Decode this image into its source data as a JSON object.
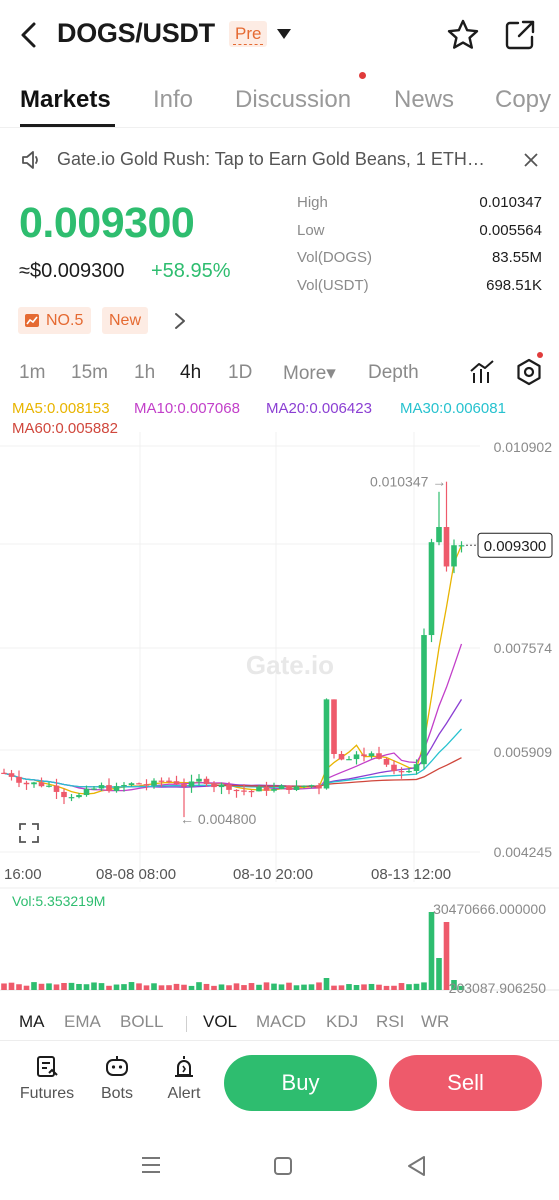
{
  "header": {
    "pair": "DOGS/USDT",
    "badge": "Pre",
    "icons": [
      "back-icon",
      "dropdown-icon",
      "star-icon",
      "share-icon"
    ]
  },
  "tabs": [
    "Markets",
    "Info",
    "Discussion",
    "News",
    "Copy"
  ],
  "active_tab": "Markets",
  "announcement": {
    "text": "Gate.io Gold Rush: Tap to Earn Gold Beans, 1 ETH…",
    "icon": "speaker-icon"
  },
  "price": {
    "last": "0.009300",
    "usd": "≈$0.009300",
    "change": "+58.95%",
    "up_color": "#2ebd6f",
    "down_color": "#ee5a6b"
  },
  "stats": [
    {
      "label": "High",
      "value": "0.010347"
    },
    {
      "label": "Low",
      "value": "0.005564"
    },
    {
      "label": "Vol(DOGS)",
      "value": "83.55M"
    },
    {
      "label": "Vol(USDT)",
      "value": "698.51K"
    }
  ],
  "badges": {
    "rank": "NO.5",
    "new": "New"
  },
  "intervals": [
    "1m",
    "15m",
    "1h",
    "4h",
    "1D",
    "More▾",
    "Depth"
  ],
  "active_interval": "4h",
  "ma_legend": [
    {
      "label": "MA5:0.008153",
      "color": "#e8b400"
    },
    {
      "label": "MA10:0.007068",
      "color": "#c23fc9"
    },
    {
      "label": "MA20:0.006423",
      "color": "#8b3fd3"
    },
    {
      "label": "MA30:0.006081",
      "color": "#27c2cf"
    },
    {
      "label": "MA60:0.005882",
      "color": "#d0473c"
    }
  ],
  "chart_data": {
    "type": "candlestick",
    "price_axis": [
      "0.010902",
      "0.009300",
      "0.007574",
      "0.005909",
      "0.004245"
    ],
    "time_labels": [
      "16:00",
      "08-08 08:00",
      "08-10 20:00",
      "08-13 12:00"
    ],
    "current_price": "0.009300",
    "high_marker": "0.010347 →",
    "low_marker": "← 0.004800",
    "ylim": [
      0.004245,
      0.010902
    ],
    "watermark": "Gate.io",
    "volume_label": "Vol:5.353219M",
    "volume_max_label": "30470666.000000",
    "volume_min_label": "203087.906250"
  },
  "indicator_tabs": [
    "MA",
    "EMA",
    "BOLL",
    "VOL",
    "MACD",
    "KDJ",
    "RSI",
    "WR"
  ],
  "active_indicators": [
    "MA",
    "VOL"
  ],
  "bottom_bar": {
    "tools": [
      {
        "label": "Futures",
        "icon": "futures-icon"
      },
      {
        "label": "Bots",
        "icon": "bots-icon"
      },
      {
        "label": "Alert",
        "icon": "alert-icon"
      }
    ],
    "buy": "Buy",
    "sell": "Sell"
  }
}
